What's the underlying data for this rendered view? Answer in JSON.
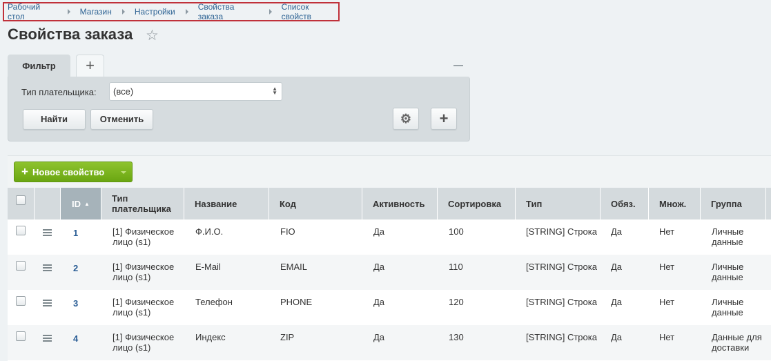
{
  "breadcrumb": [
    "Рабочий стол",
    "Магазин",
    "Настройки",
    "Свойства заказа",
    "Список свойств"
  ],
  "page": {
    "title": "Свойства заказа"
  },
  "filter": {
    "tab_label": "Фильтр",
    "payer_label": "Тип плательщика:",
    "payer_value": "(все)",
    "find_label": "Найти",
    "cancel_label": "Отменить"
  },
  "toolbar": {
    "new_label": "Новое свойство"
  },
  "table": {
    "headers": {
      "id": "ID",
      "payer": "Тип плательщика",
      "name": "Название",
      "code": "Код",
      "active": "Активность",
      "sort": "Сортировка",
      "type": "Тип",
      "required": "Обяз.",
      "multiple": "Множ.",
      "group": "Группа"
    },
    "rows": [
      {
        "id": "1",
        "payer": "[1] Физическое лицо (s1)",
        "name": "Ф.И.О.",
        "code": "FIO",
        "active": "Да",
        "sort": "100",
        "type": "[STRING] Строка",
        "required": "Да",
        "multiple": "Нет",
        "group": "Личные данные"
      },
      {
        "id": "2",
        "payer": "[1] Физическое лицо (s1)",
        "name": "E-Mail",
        "code": "EMAIL",
        "active": "Да",
        "sort": "110",
        "type": "[STRING] Строка",
        "required": "Да",
        "multiple": "Нет",
        "group": "Личные данные"
      },
      {
        "id": "3",
        "payer": "[1] Физическое лицо (s1)",
        "name": "Телефон",
        "code": "PHONE",
        "active": "Да",
        "sort": "120",
        "type": "[STRING] Строка",
        "required": "Да",
        "multiple": "Нет",
        "group": "Личные данные"
      },
      {
        "id": "4",
        "payer": "[1] Физическое лицо (s1)",
        "name": "Индекс",
        "code": "ZIP",
        "active": "Да",
        "sort": "130",
        "type": "[STRING] Строка",
        "required": "Да",
        "multiple": "Нет",
        "group": "Данные для доставки"
      }
    ]
  }
}
